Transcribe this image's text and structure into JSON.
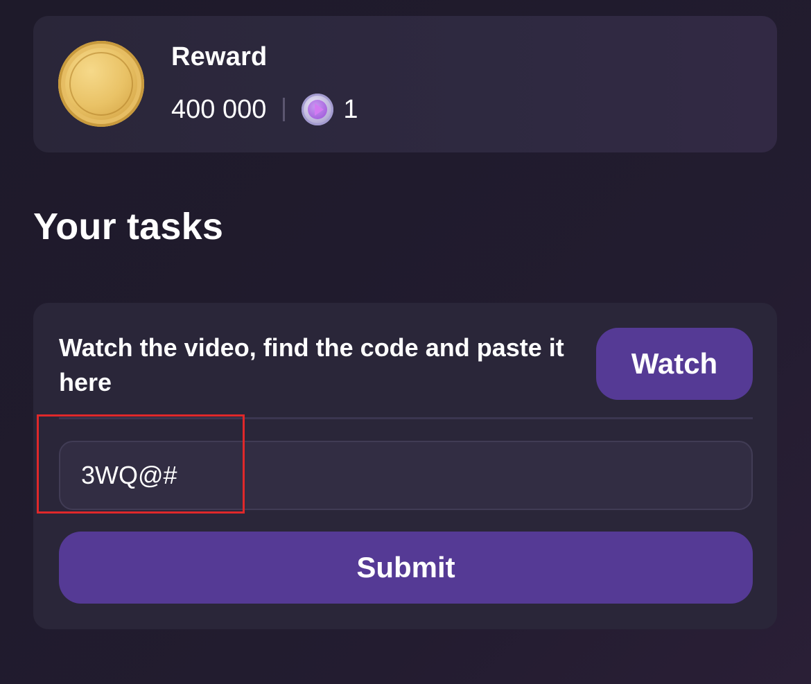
{
  "reward": {
    "title": "Reward",
    "coins": "400 000",
    "video_count": "1",
    "icons": {
      "coin": "gold-coin-icon",
      "video": "play-circle-icon"
    }
  },
  "tasks_section": {
    "title": "Your tasks"
  },
  "task": {
    "instruction": "Watch the video, find the code and paste it here",
    "watch_label": "Watch",
    "code_value": "3WQ@#",
    "submit_label": "Submit"
  },
  "colors": {
    "accent": "#553a95",
    "highlight": "#e0282a",
    "card": "#2a2639"
  }
}
